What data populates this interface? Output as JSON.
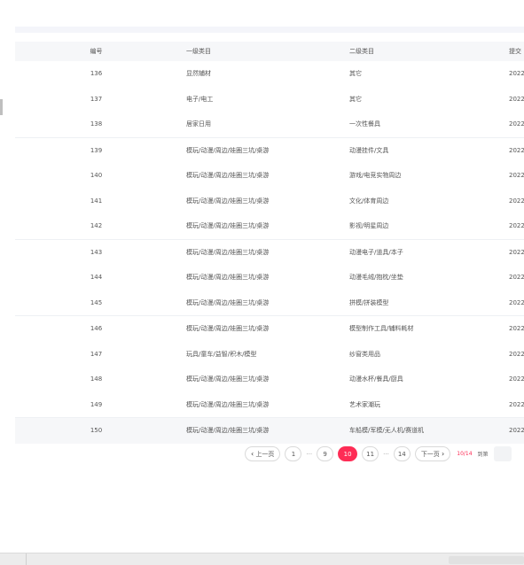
{
  "table": {
    "columns": [
      "编号",
      "一级类目",
      "二级类目",
      "提交"
    ],
    "rows": [
      {
        "id": "136",
        "l1": "显然辅材",
        "l2": "其它",
        "d": "2022"
      },
      {
        "id": "137",
        "l1": "电子/电工",
        "l2": "其它",
        "d": "2022"
      },
      {
        "id": "138",
        "l1": "居家日用",
        "l2": "一次性餐具",
        "d": "2022"
      },
      {
        "id": "139",
        "l1": "模玩/动漫/周边/娃圈三坑/桌游",
        "l2": "动漫挂件/文具",
        "d": "2022"
      },
      {
        "id": "140",
        "l1": "模玩/动漫/周边/娃圈三坑/桌游",
        "l2": "游戏/电竞实物周边",
        "d": "2022"
      },
      {
        "id": "141",
        "l1": "模玩/动漫/周边/娃圈三坑/桌游",
        "l2": "文化/体育周边",
        "d": "2022"
      },
      {
        "id": "142",
        "l1": "模玩/动漫/周边/娃圈三坑/桌游",
        "l2": "影视/明星周边",
        "d": "2022"
      },
      {
        "id": "143",
        "l1": "模玩/动漫/周边/娃圈三坑/桌游",
        "l2": "动漫电子/道具/本子",
        "d": "2022"
      },
      {
        "id": "144",
        "l1": "模玩/动漫/周边/娃圈三坑/桌游",
        "l2": "动漫毛绒/抱枕/坐垫",
        "d": "2022"
      },
      {
        "id": "145",
        "l1": "模玩/动漫/周边/娃圈三坑/桌游",
        "l2": "拼模/拼装模型",
        "d": "2022"
      },
      {
        "id": "146",
        "l1": "模玩/动漫/周边/娃圈三坑/桌游",
        "l2": "模型制作工具/辅料耗材",
        "d": "2022"
      },
      {
        "id": "147",
        "l1": "玩具/童车/益智/积木/模型",
        "l2": "纱窗类用品",
        "d": "2022"
      },
      {
        "id": "148",
        "l1": "模玩/动漫/周边/娃圈三坑/桌游",
        "l2": "动漫水杯/餐具/厨具",
        "d": "2022"
      },
      {
        "id": "149",
        "l1": "模玩/动漫/周边/娃圈三坑/桌游",
        "l2": "艺术家潮玩",
        "d": "2022"
      },
      {
        "id": "150",
        "l1": "模玩/动漫/周边/娃圈三坑/桌游",
        "l2": "车船模/军模/无人机/赛道机",
        "d": "2022"
      }
    ]
  },
  "pagination": {
    "prev_label": "上一页",
    "next_label": "下一页",
    "first": "1",
    "ellipsis": "···",
    "p9": "9",
    "current": "10",
    "p11": "11",
    "last": "14",
    "page_info": "10/14",
    "jump_label": "到第"
  },
  "colors": {
    "accent": "#fe2c55"
  }
}
